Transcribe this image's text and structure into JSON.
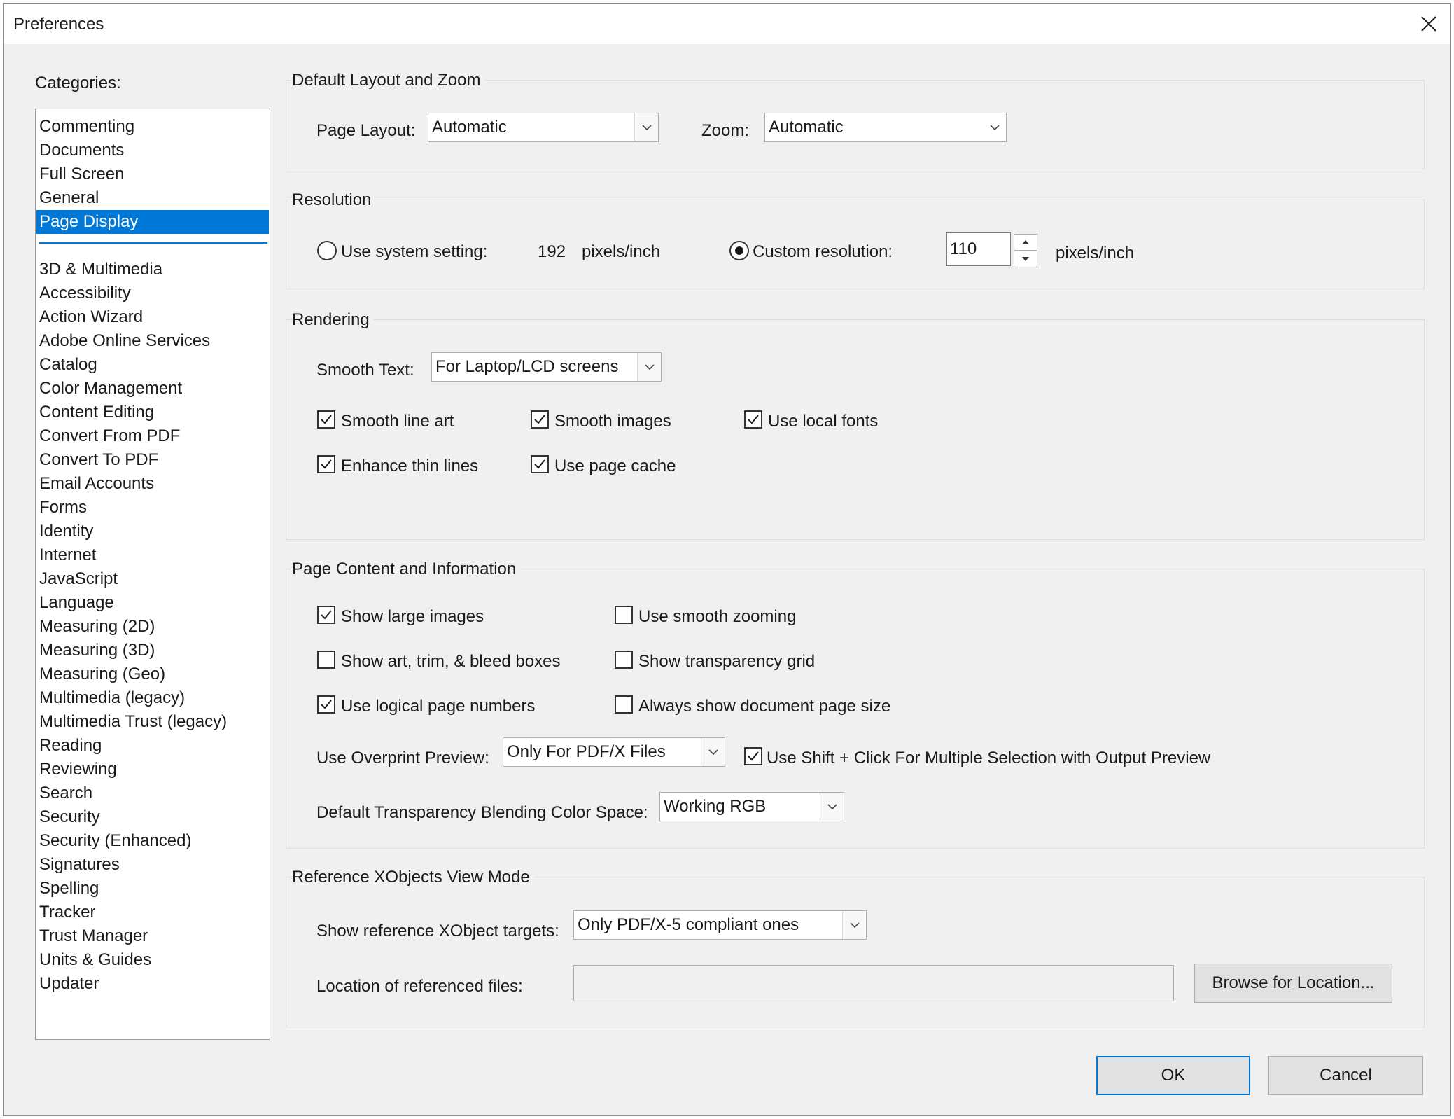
{
  "window": {
    "title": "Preferences"
  },
  "categories": {
    "label": "Categories:",
    "selected": "Page Display",
    "top_items": [
      "Commenting",
      "Documents",
      "Full Screen",
      "General",
      "Page Display"
    ],
    "items": [
      "3D & Multimedia",
      "Accessibility",
      "Action Wizard",
      "Adobe Online Services",
      "Catalog",
      "Color Management",
      "Content Editing",
      "Convert From PDF",
      "Convert To PDF",
      "Email Accounts",
      "Forms",
      "Identity",
      "Internet",
      "JavaScript",
      "Language",
      "Measuring (2D)",
      "Measuring (3D)",
      "Measuring (Geo)",
      "Multimedia (legacy)",
      "Multimedia Trust (legacy)",
      "Reading",
      "Reviewing",
      "Search",
      "Security",
      "Security (Enhanced)",
      "Signatures",
      "Spelling",
      "Tracker",
      "Trust Manager",
      "Units & Guides",
      "Updater"
    ]
  },
  "layout_zoom": {
    "title": "Default Layout and Zoom",
    "page_layout_label": "Page Layout:",
    "page_layout_value": "Automatic",
    "zoom_label": "Zoom:",
    "zoom_value": "Automatic"
  },
  "resolution": {
    "title": "Resolution",
    "system_label": "Use system setting:",
    "system_value": "192",
    "system_unit": "pixels/inch",
    "custom_label": "Custom resolution:",
    "custom_value": "110",
    "custom_unit": "pixels/inch",
    "selected": "custom"
  },
  "rendering": {
    "title": "Rendering",
    "smooth_text_label": "Smooth Text:",
    "smooth_text_value": "For Laptop/LCD screens",
    "checks": {
      "smooth_line_art": {
        "label": "Smooth line art",
        "checked": true
      },
      "smooth_images": {
        "label": "Smooth images",
        "checked": true
      },
      "use_local_fonts": {
        "label": "Use local fonts",
        "checked": true
      },
      "enhance_thin_lines": {
        "label": "Enhance thin lines",
        "checked": true
      },
      "use_page_cache": {
        "label": "Use page cache",
        "checked": true
      }
    }
  },
  "page_content": {
    "title": "Page Content and Information",
    "checks": {
      "show_large_images": {
        "label": "Show large images",
        "checked": true
      },
      "use_smooth_zooming": {
        "label": "Use smooth zooming",
        "checked": false
      },
      "show_art_trim_bleed": {
        "label": "Show art, trim, & bleed boxes",
        "checked": false
      },
      "show_transparency_grid": {
        "label": "Show transparency grid",
        "checked": false
      },
      "use_logical_page_numbers": {
        "label": "Use logical page numbers",
        "checked": true
      },
      "always_show_page_size": {
        "label": "Always show document page size",
        "checked": false
      },
      "use_shift_click": {
        "label": "Use Shift + Click For Multiple Selection with Output Preview",
        "checked": true
      }
    },
    "overprint_label": "Use Overprint Preview:",
    "overprint_value": "Only For PDF/X Files",
    "blending_label": "Default Transparency Blending Color Space:",
    "blending_value": "Working RGB"
  },
  "xobjects": {
    "title": "Reference XObjects View Mode",
    "targets_label": "Show reference XObject targets:",
    "targets_value": "Only PDF/X-5 compliant ones",
    "location_label": "Location of referenced files:",
    "location_value": "",
    "browse_label": "Browse for Location..."
  },
  "footer": {
    "ok_label": "OK",
    "cancel_label": "Cancel"
  }
}
